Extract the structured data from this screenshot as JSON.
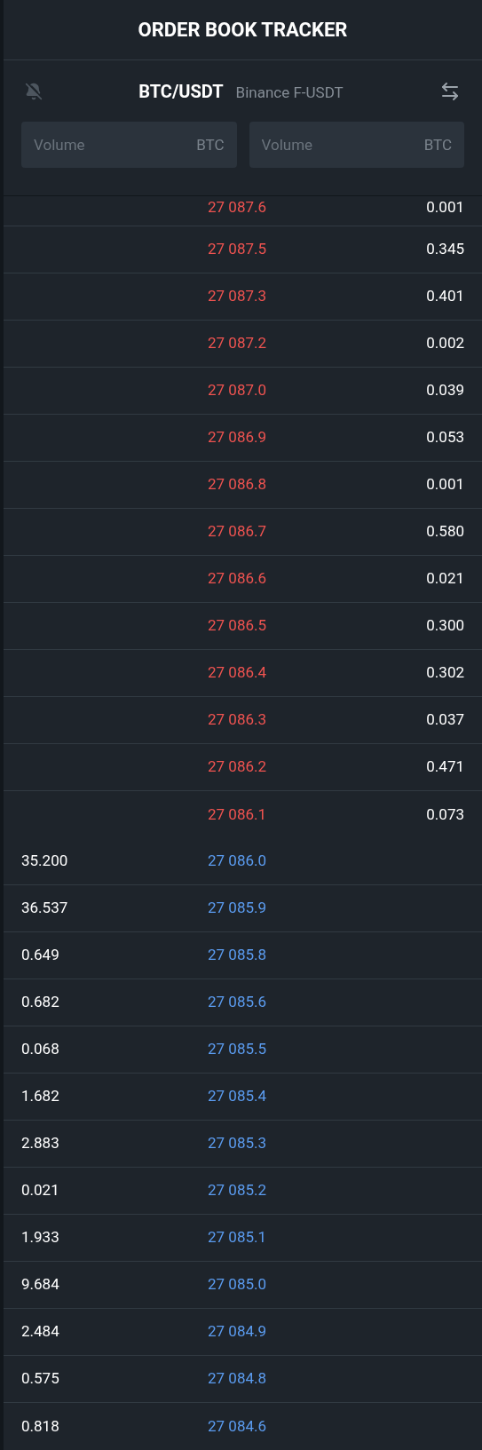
{
  "title": "ORDER BOOK TRACKER",
  "pair": {
    "symbol": "BTC/USDT",
    "exchange": "Binance F-USDT"
  },
  "inputs": [
    {
      "placeholder": "Volume",
      "unit": "BTC"
    },
    {
      "placeholder": "Volume",
      "unit": "BTC"
    }
  ],
  "rows": [
    {
      "kind": "ask",
      "price": "27 087.6",
      "quantity": "0.001"
    },
    {
      "kind": "ask",
      "price": "27 087.5",
      "quantity": "0.345"
    },
    {
      "kind": "ask",
      "price": "27 087.3",
      "quantity": "0.401"
    },
    {
      "kind": "ask",
      "price": "27 087.2",
      "quantity": "0.002"
    },
    {
      "kind": "ask",
      "price": "27 087.0",
      "quantity": "0.039"
    },
    {
      "kind": "ask",
      "price": "27 086.9",
      "quantity": "0.053"
    },
    {
      "kind": "ask",
      "price": "27 086.8",
      "quantity": "0.001"
    },
    {
      "kind": "ask",
      "price": "27 086.7",
      "quantity": "0.580"
    },
    {
      "kind": "ask",
      "price": "27 086.6",
      "quantity": "0.021"
    },
    {
      "kind": "ask",
      "price": "27 086.5",
      "quantity": "0.300"
    },
    {
      "kind": "ask",
      "price": "27 086.4",
      "quantity": "0.302"
    },
    {
      "kind": "ask",
      "price": "27 086.3",
      "quantity": "0.037"
    },
    {
      "kind": "ask",
      "price": "27 086.2",
      "quantity": "0.471"
    },
    {
      "kind": "ask",
      "price": "27 086.1",
      "quantity": "0.073"
    },
    {
      "kind": "bid",
      "price": "27 086.0",
      "quantity": "35.200"
    },
    {
      "kind": "bid",
      "price": "27 085.9",
      "quantity": "36.537"
    },
    {
      "kind": "bid",
      "price": "27 085.8",
      "quantity": "0.649"
    },
    {
      "kind": "bid",
      "price": "27 085.6",
      "quantity": "0.682"
    },
    {
      "kind": "bid",
      "price": "27 085.5",
      "quantity": "0.068"
    },
    {
      "kind": "bid",
      "price": "27 085.4",
      "quantity": "1.682"
    },
    {
      "kind": "bid",
      "price": "27 085.3",
      "quantity": "2.883"
    },
    {
      "kind": "bid",
      "price": "27 085.2",
      "quantity": "0.021"
    },
    {
      "kind": "bid",
      "price": "27 085.1",
      "quantity": "1.933"
    },
    {
      "kind": "bid",
      "price": "27 085.0",
      "quantity": "9.684"
    },
    {
      "kind": "bid",
      "price": "27 084.9",
      "quantity": "2.484"
    },
    {
      "kind": "bid",
      "price": "27 084.8",
      "quantity": "0.575"
    },
    {
      "kind": "bid",
      "price": "27 084.6",
      "quantity": "0.818"
    }
  ]
}
